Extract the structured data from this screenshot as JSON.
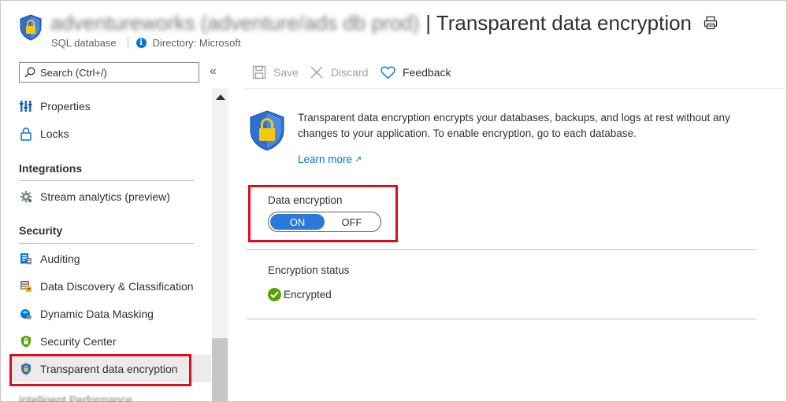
{
  "header": {
    "resource_name_obscured": "adventureworks (adventure/ads db prod)",
    "title": "| Transparent data encryption",
    "resource_type": "SQL database",
    "directory": "Directory: Microsoft"
  },
  "sidebar": {
    "search_placeholder": "Search (Ctrl+/)",
    "collapse_glyph": "«",
    "items": [
      {
        "label": "Properties",
        "icon": "properties-icon"
      },
      {
        "label": "Locks",
        "icon": "lock-icon"
      }
    ],
    "sections": [
      {
        "title": "Integrations",
        "items": [
          {
            "label": "Stream analytics (preview)",
            "icon": "gear-icon"
          }
        ]
      },
      {
        "title": "Security",
        "items": [
          {
            "label": "Auditing",
            "icon": "auditing-icon"
          },
          {
            "label": "Data Discovery & Classification",
            "icon": "data-discovery-icon"
          },
          {
            "label": "Dynamic Data Masking",
            "icon": "masking-icon"
          },
          {
            "label": "Security Center",
            "icon": "security-center-icon"
          },
          {
            "label": "Transparent data encryption",
            "icon": "shield-lock-icon",
            "selected": true
          }
        ]
      }
    ],
    "cutoff_label": "Intelligent Performance"
  },
  "toolbar": {
    "save": "Save",
    "discard": "Discard",
    "feedback": "Feedback"
  },
  "main": {
    "description": "Transparent data encryption encrypts your databases, backups, and logs at rest without any changes to your application. To enable encryption, go to each database.",
    "learn_more": "Learn more",
    "data_encryption_label": "Data encryption",
    "toggle": {
      "on": "ON",
      "off": "OFF",
      "selected": "ON"
    },
    "encryption_status_label": "Encryption status",
    "encryption_status_value": "Encrypted"
  },
  "colors": {
    "accent": "#0078d4",
    "toggle_on": "#2b79d8",
    "highlight_box": "#e00b1c",
    "status_ok": "#57a300",
    "shield_blue": "#2f6fcf",
    "lock_yellow": "#f2c811"
  }
}
